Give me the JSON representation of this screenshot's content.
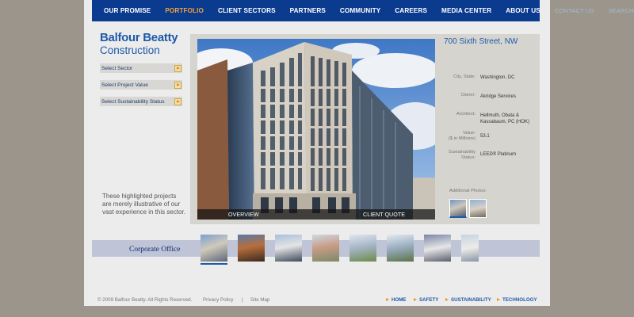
{
  "nav": {
    "items": [
      "OUR PROMISE",
      "PORTFOLIO",
      "CLIENT SECTORS",
      "PARTNERS",
      "COMMUNITY",
      "CAREERS",
      "MEDIA CENTER",
      "ABOUT US"
    ],
    "active": "PORTFOLIO",
    "contact": "CONTACT US",
    "search": "SEARCH"
  },
  "logo": {
    "line1": "Balfour Beatty",
    "line2": "Construction"
  },
  "selectors": [
    "Select Sector",
    "Select Project Value",
    "Select Sustainability Status"
  ],
  "note": "These highlighted projects are merely illustrative of our vast experience in this sector.",
  "photo_bar": {
    "overview": "OVERVIEW",
    "quote": "CLIENT QUOTE"
  },
  "project": {
    "address": "700 Sixth Street, NW",
    "labels": {
      "location": "City, State:",
      "owner": "Owner:",
      "architect": "Architect:",
      "value": "Value:\n($ in Millions)",
      "sustainability": "Sustainability\nStatus:"
    },
    "values": {
      "location": "Washington, DC",
      "owner": "Akridge Services",
      "architect": "Hellmuth, Obata &\nKassabaum, PC (HOK)",
      "value": "53.1",
      "sustainability": "LEED® Platinum"
    },
    "additional_photos_label": "Additional Photos:"
  },
  "strip": {
    "title": "Corporate Office"
  },
  "footer": {
    "copyright": "© 2009 Balfour Beatty. All Rights Reserved.",
    "privacy": "Privacy Policy",
    "divider": "|",
    "sitemap": "Site Map",
    "links": [
      "HOME",
      "SAFETY",
      "SUSTAINABILITY",
      "TECHNOLOGY"
    ]
  },
  "colors": {
    "nav_bg": "#0a3b8f",
    "accent": "#1e5aa8",
    "active_nav": "#f0a13a",
    "arrow": "#e8961e"
  }
}
